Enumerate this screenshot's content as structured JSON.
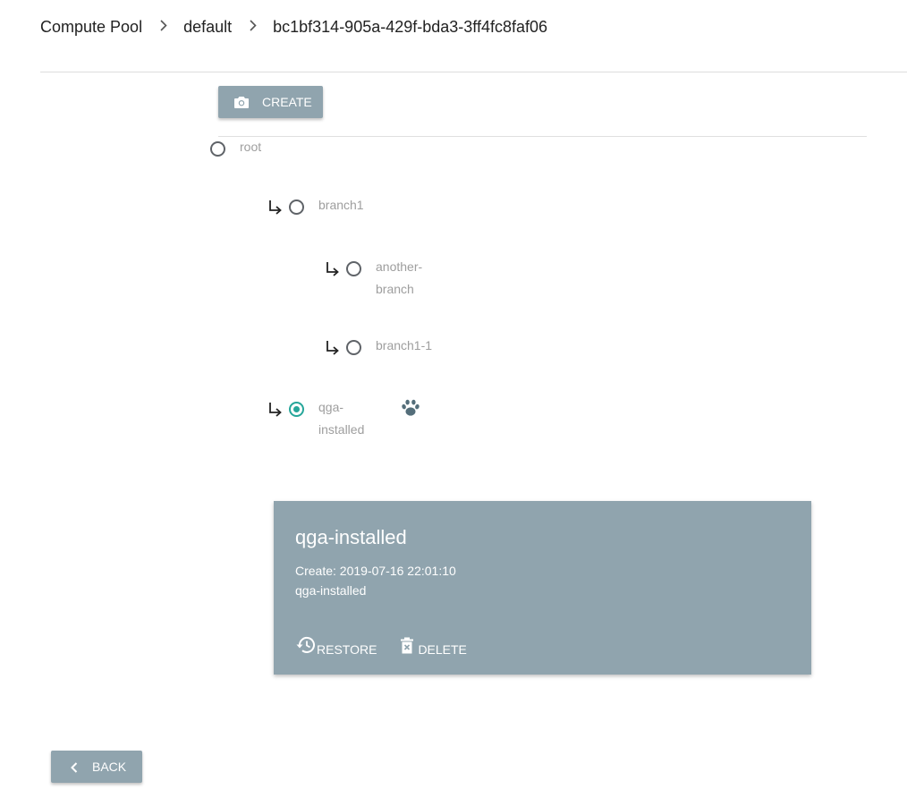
{
  "breadcrumb": {
    "items": [
      "Compute Pool",
      "default",
      "bc1bf314-905a-429f-bda3-3ff4fc8faf06"
    ],
    "separator_icon": "chevron-right-icon"
  },
  "toolbar": {
    "create_label": "CREATE",
    "create_icon": "camera-icon"
  },
  "tree": {
    "nodes": [
      {
        "label": "root",
        "depth": 0,
        "selected": false
      },
      {
        "label": "branch1",
        "depth": 1,
        "selected": false
      },
      {
        "label": "another-branch",
        "depth": 2,
        "selected": false
      },
      {
        "label": "branch1-1",
        "depth": 2,
        "selected": false
      },
      {
        "label": "qga-installed",
        "depth": 1,
        "selected": true,
        "current_marker_icon": "paw-icon"
      }
    ]
  },
  "detail": {
    "title": "qga-installed",
    "created": "Create: 2019-07-16 22:01:10",
    "description": "qga-installed",
    "restore_label": "RESTORE",
    "delete_label": "DELETE"
  },
  "footer": {
    "back_label": "BACK"
  },
  "colors": {
    "accent": "#26a69a",
    "button_bg": "#90a4ae",
    "card_bg": "#90a4ae",
    "muted_text": "#9e9e9e"
  }
}
